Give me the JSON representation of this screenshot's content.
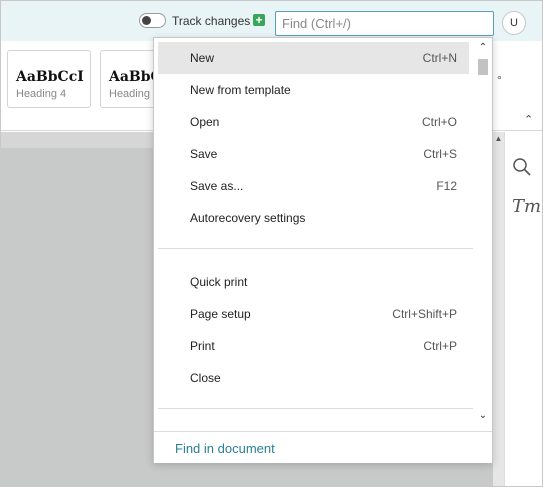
{
  "header": {
    "track_changes_label": "Track changes",
    "track_changes_on": false,
    "find_placeholder": "Find (Ctrl+/)",
    "user_initial": "U"
  },
  "ribbon": {
    "styles": [
      {
        "sample": "AaBbCcI",
        "name": "Heading 4"
      },
      {
        "sample": "AaBbC",
        "name": "Heading"
      }
    ]
  },
  "file_menu": {
    "items": [
      {
        "label": "New",
        "shortcut": "Ctrl+N"
      },
      {
        "label": "New from template",
        "shortcut": ""
      },
      {
        "label": "Open",
        "shortcut": "Ctrl+O"
      },
      {
        "label": "Save",
        "shortcut": "Ctrl+S"
      },
      {
        "label": "Save as...",
        "shortcut": "F12"
      },
      {
        "label": "Autorecovery settings",
        "shortcut": ""
      },
      {
        "label": "Quick print",
        "shortcut": ""
      },
      {
        "label": "Page setup",
        "shortcut": "Ctrl+Shift+P"
      },
      {
        "label": "Print",
        "shortcut": "Ctrl+P"
      },
      {
        "label": "Close",
        "shortcut": ""
      }
    ],
    "footer_link": "Find in document"
  },
  "colors": {
    "header_bg": "#e9f4f7",
    "accent": "#2a7f95",
    "add_icon": "#3aa55a",
    "canvas_bg": "#c8c9c9",
    "menu_highlight": "#e6e6e6"
  }
}
